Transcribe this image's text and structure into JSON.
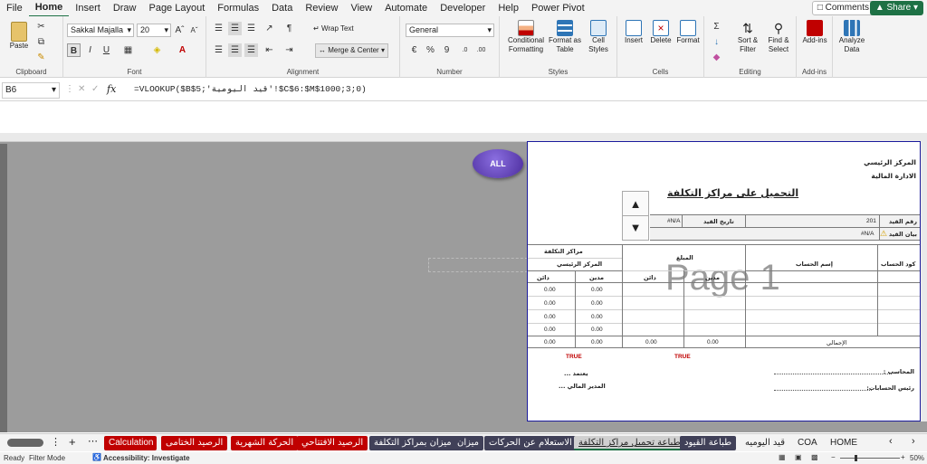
{
  "menu": {
    "items": [
      "File",
      "Home",
      "Insert",
      "Draw",
      "Page Layout",
      "Formulas",
      "Data",
      "Review",
      "View",
      "Automate",
      "Developer",
      "Help",
      "Power Pivot"
    ],
    "active": "Home",
    "comments": "Comments",
    "share": "Share"
  },
  "ribbon": {
    "clipboard": {
      "paste": "Paste",
      "label": "Clipboard"
    },
    "font": {
      "name": "Sakkal Majalla",
      "size": "20",
      "label": "Font"
    },
    "alignment": {
      "wrap_text": "Wrap Text",
      "merge_center": "Merge & Center",
      "label": "Alignment"
    },
    "number": {
      "format": "General",
      "label": "Number"
    },
    "styles": {
      "conditional": "Conditional Formatting",
      "format_table": "Format as Table",
      "cell_styles": "Cell Styles",
      "label": "Styles"
    },
    "cells": {
      "insert": "Insert",
      "delete": "Delete",
      "format": "Format",
      "label": "Cells"
    },
    "editing": {
      "sort_filter": "Sort & Filter",
      "find_select": "Find & Select",
      "label": "Editing"
    },
    "addins": {
      "addins": "Add-ins",
      "label": "Add-ins"
    },
    "analyze": {
      "label": "Analyze Data"
    }
  },
  "formula_bar": {
    "name_box": "B6",
    "fx": "fx",
    "formula": "=VLOOKUP($B$5;'قيد اليومية'!$C$6:$M$1000;3;0)"
  },
  "sheet": {
    "all_button": "ALL",
    "watermark": "Page 1",
    "org_line1": "المركز الرئيسي",
    "org_line2": "الادارة المالية",
    "title": "التحميل على مراكز التكلفة",
    "entry_no_label": "رقم القيد",
    "entry_no_value": "201",
    "entry_date_label": "تاريخ القيد",
    "entry_date_value": "#N/A",
    "entry_desc_label": "بيان القيد",
    "entry_desc_value": "#N/A",
    "col_account_code": "كود الحساب",
    "col_account_name": "إسم الحساب",
    "col_amount": "المبلغ",
    "col_debit": "مدين",
    "col_credit": "دائن",
    "col_cost_centers": "مراكز التكلفة",
    "col_head_office": "المركز الرئيسي",
    "cc_rows": [
      {
        "debit": "0.00",
        "credit": "0.00"
      },
      {
        "debit": "0.00",
        "credit": "0.00"
      },
      {
        "debit": "0.00",
        "credit": "0.00"
      },
      {
        "debit": "0.00",
        "credit": "0.00"
      }
    ],
    "total_label": "الإجمالي",
    "total_debit": "0.00",
    "total_credit": "0.00",
    "cc_total_debit": "0.00",
    "cc_total_credit": "0.00",
    "true_left": "TRUE",
    "true_right": "TRUE",
    "accountant": "المحاسب :",
    "chief_accounts": "رئيس الحسابات:",
    "approved": "يعتمد ...",
    "finance_manager": "المدير المالي ..."
  },
  "tabs": [
    "HOME",
    "COA",
    "قيد اليوميه",
    "طباعة القيود",
    "طباعة تحميل مراكز التكلفة",
    "الاستعلام عن الحركات",
    "ميزان",
    "ميزان بمراكز التكلفة",
    "الرصيد الافتتاحي",
    "الحركة الشهرية",
    "الرصيد الختامى",
    "Calculation"
  ],
  "active_tab": "طباعة تحميل مراكز التكلفة",
  "status": {
    "ready": "Ready",
    "filter_mode": "Filter Mode",
    "accessibility": "Accessibility: Investigate",
    "zoom": "50%"
  },
  "colors": {
    "excel_green": "#1e7145",
    "tab_red": "#c00000",
    "tab_dark": "#404058",
    "all_button": "#5a3cb0",
    "page_border": "#1b1b9c"
  }
}
